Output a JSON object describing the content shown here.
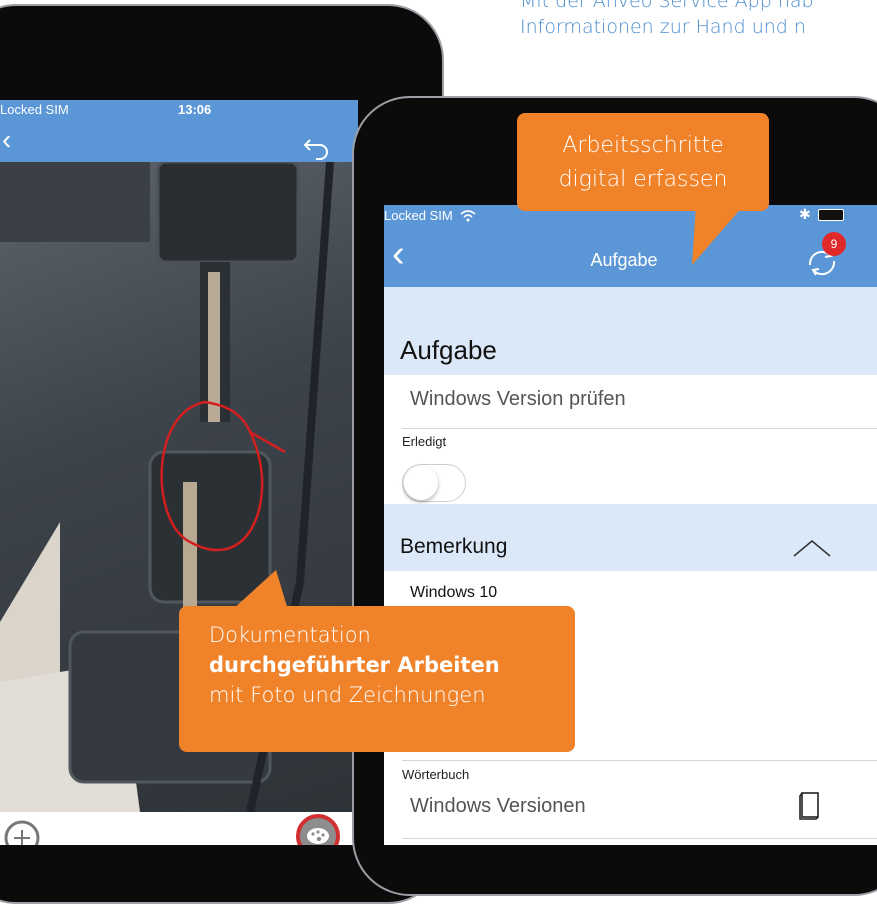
{
  "header": {
    "line1": "Mit der Anveo Service App hab",
    "line2": "Informationen zur Hand und n"
  },
  "left_phone": {
    "status_carrier": "Locked SIM",
    "status_time": "13:06"
  },
  "right_phone": {
    "status_carrier": "Locked SIM",
    "nav_title": "Aufgabe",
    "sync_badge": "9",
    "section_task_title": "Aufgabe",
    "task_value": "Windows Version prüfen",
    "done_label": "Erledigt",
    "done_toggle": false,
    "section_remark_title": "Bemerkung",
    "remark_value": "Windows 10",
    "dictionary_label": "Wörterbuch",
    "dictionary_value": "Windows Versionen"
  },
  "callouts": {
    "top_line1": "Arbeitsschritte",
    "top_line2": "digital erfassen",
    "bottom_line1": "Dokumentation",
    "bottom_line2_bold": "durchgeführter Arbeiten",
    "bottom_line3": "mit Foto und Zeichnungen"
  },
  "colors": {
    "nav_blue": "#5b97d6",
    "section_band": "#dbe8f8",
    "callout_orange": "#f0822a",
    "badge_red": "#e02a2a"
  }
}
